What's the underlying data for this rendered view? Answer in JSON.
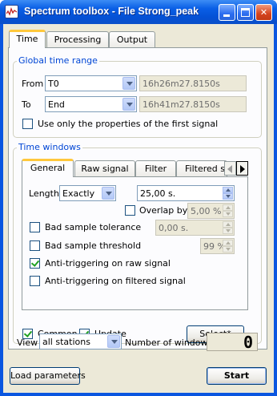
{
  "window": {
    "title": "Spectrum toolbox - File Strong_peak"
  },
  "main_tabs": [
    "Time",
    "Processing",
    "Output"
  ],
  "global_time_range": {
    "label": "Global time range",
    "from_label": "From",
    "from_value": "T0",
    "from_time": "16h26m27.8150s",
    "to_label": "To",
    "to_value": "End",
    "to_time": "16h41m27.8150s",
    "first_signal_label": "Use only the properties of the first signal"
  },
  "time_windows": {
    "label": "Time windows",
    "tabs": [
      "General",
      "Raw signal",
      "Filter",
      "Filtered si"
    ],
    "length_label": "Length",
    "length_mode": "Exactly",
    "length_value": "25,00 s.",
    "overlap_label": "Overlap by",
    "overlap_value": "5,00 %",
    "bad_tol_label": "Bad sample tolerance",
    "bad_tol_value": "0,00 s.",
    "bad_thr_label": "Bad sample threshold",
    "bad_thr_value": "99 %",
    "anti_raw_label": "Anti-triggering on raw signal",
    "anti_filt_label": "Anti-triggering on filtered signal",
    "common_label": "Common",
    "update_label": "Update",
    "select_label": "Select*"
  },
  "footer": {
    "view_label": "View",
    "view_value": "all stations",
    "num_windows_label": "Number of windows",
    "num_windows_value": "0",
    "load_label": "Load parameters",
    "start_label": "Start"
  },
  "states": {
    "first_signal": false,
    "overlap": false,
    "bad_tol": false,
    "bad_thr": false,
    "anti_raw": true,
    "anti_filt": false,
    "common": true,
    "update": true
  }
}
